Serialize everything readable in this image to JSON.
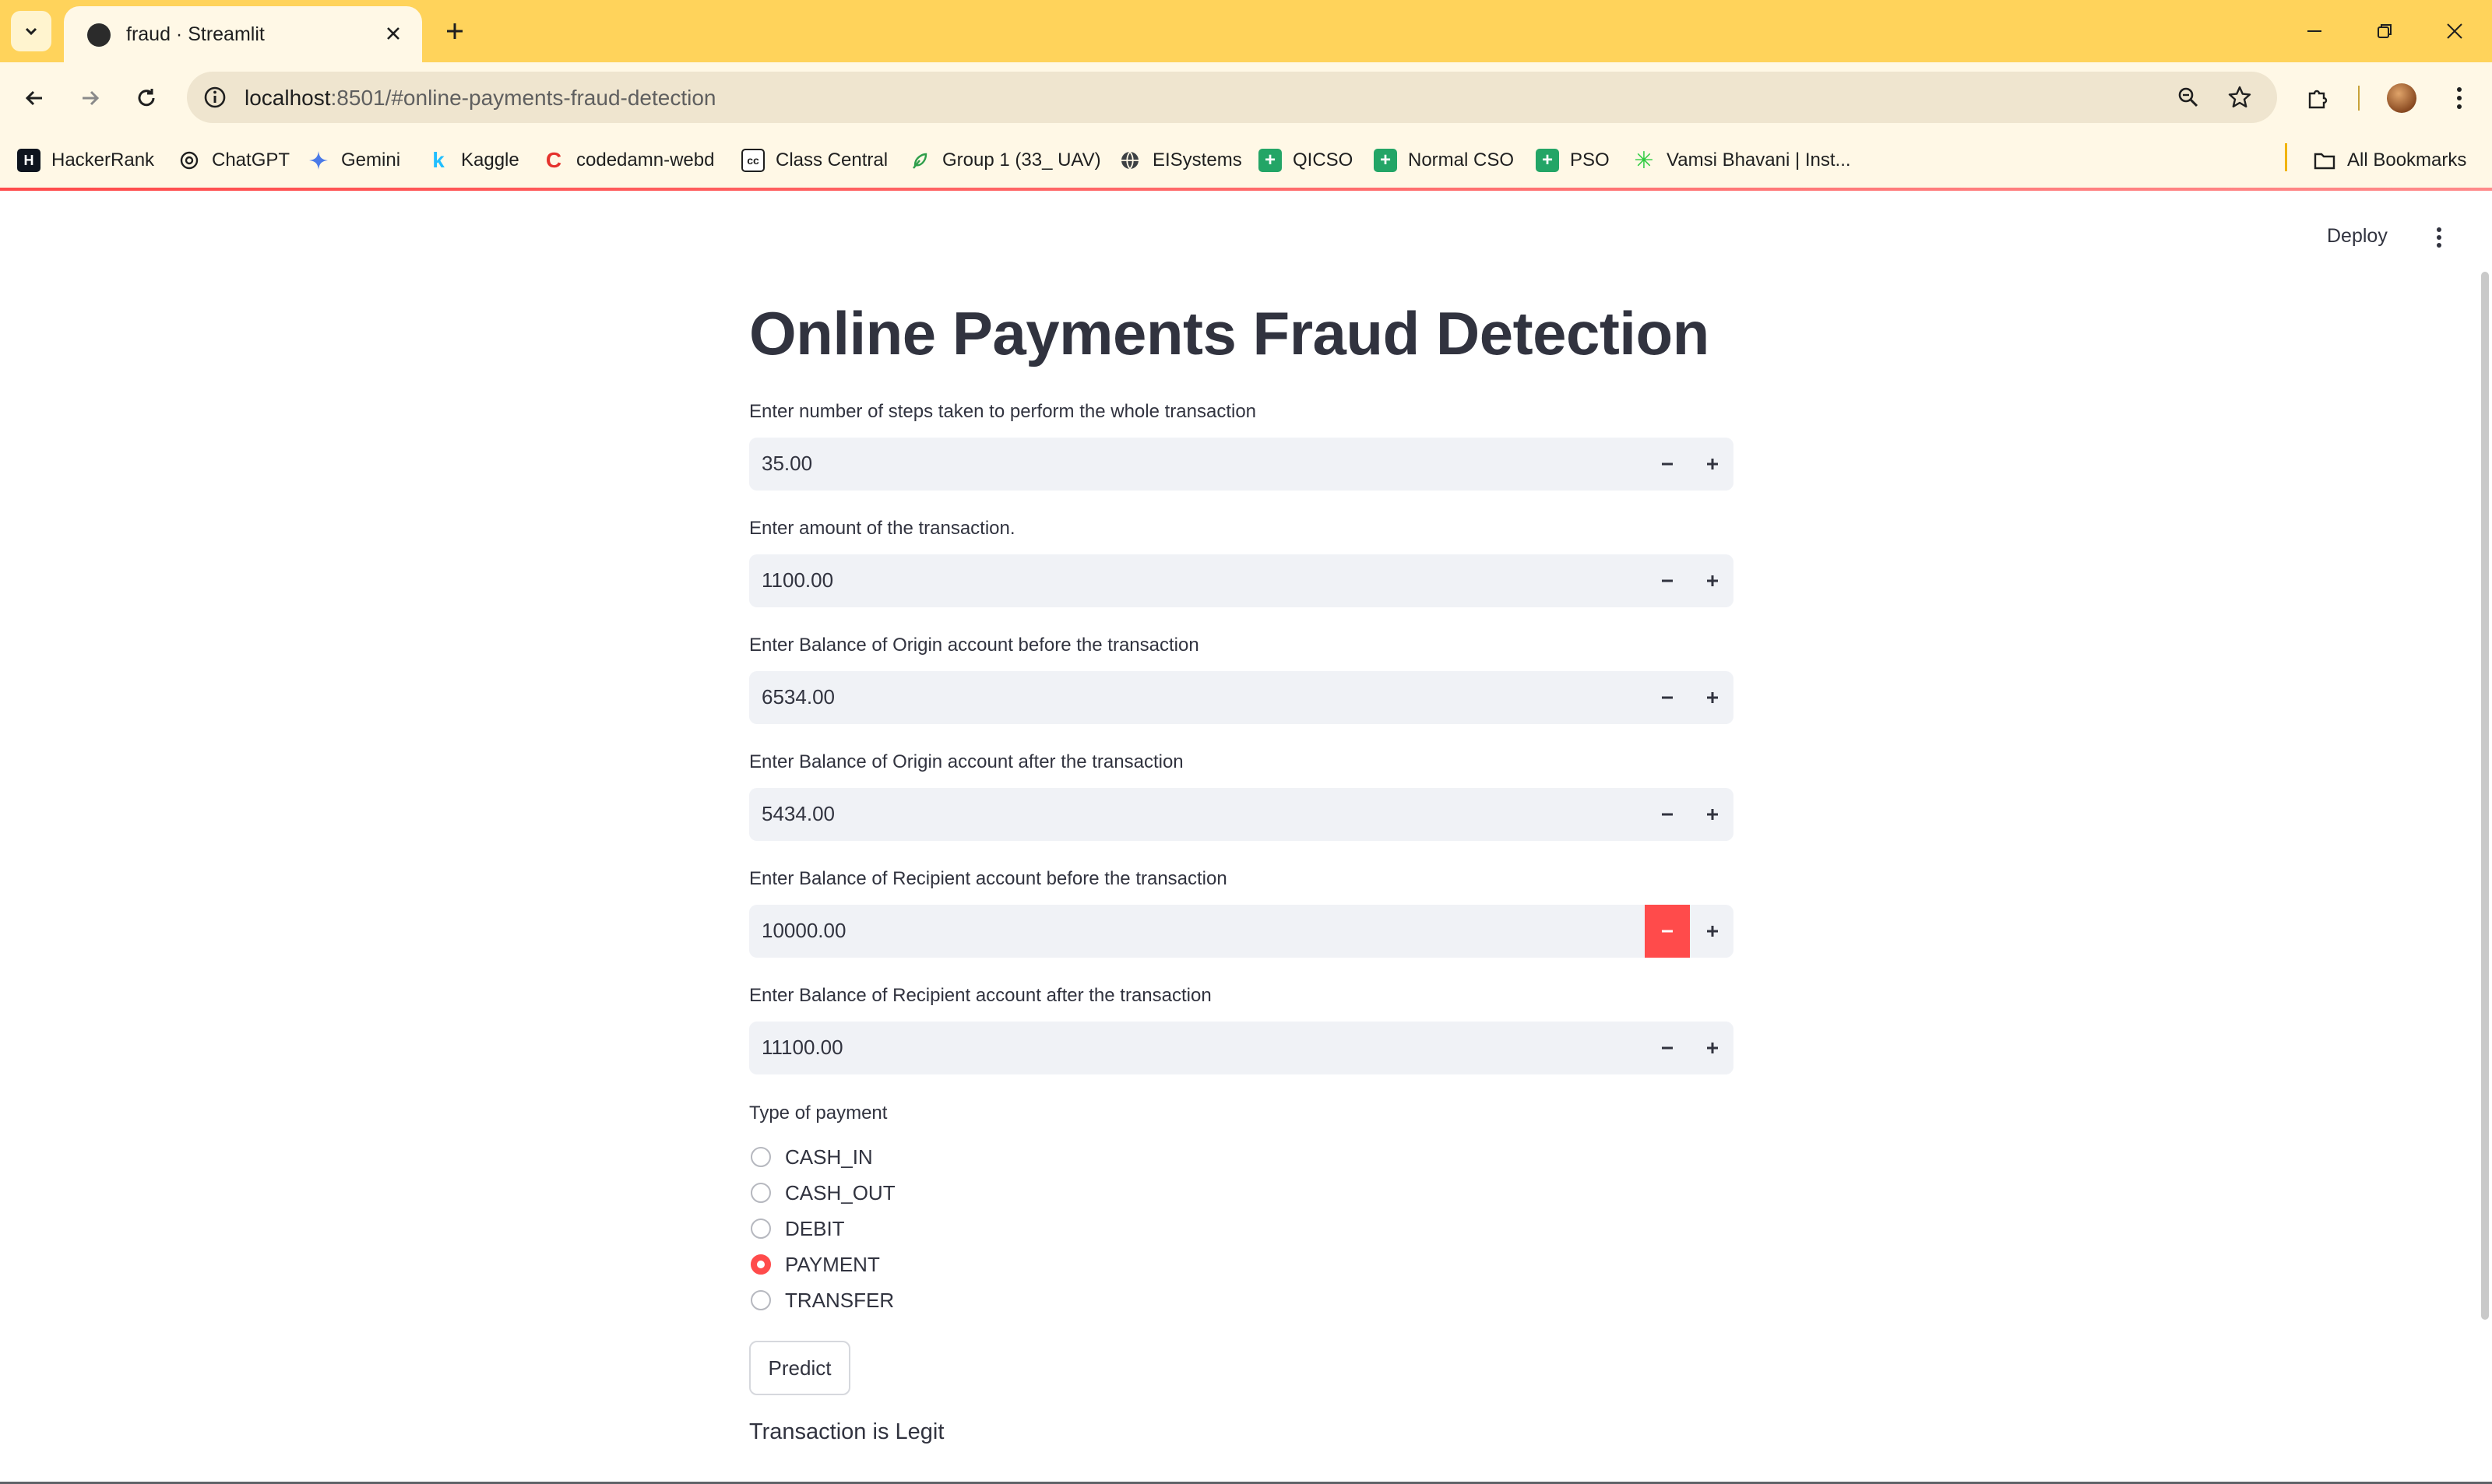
{
  "browser": {
    "tab_title": "fraud · Streamlit",
    "url_host": "localhost",
    "url_rest": ":8501/#online-payments-fraud-detection",
    "accent": "#ffd35b",
    "bookmarks": [
      {
        "label": "HackerRank",
        "icon": "hackerrank-icon"
      },
      {
        "label": "ChatGPT",
        "icon": "chatgpt-icon"
      },
      {
        "label": "Gemini",
        "icon": "gemini-icon"
      },
      {
        "label": "Kaggle",
        "icon": "kaggle-icon"
      },
      {
        "label": "codedamn-webd",
        "icon": "codedamn-icon"
      },
      {
        "label": "Class Central",
        "icon": "classcentral-icon"
      },
      {
        "label": "Group 1 (33_ UAV)",
        "icon": "group-icon"
      },
      {
        "label": "EISystems",
        "icon": "globe-icon"
      },
      {
        "label": "QICSO",
        "icon": "sheets-icon"
      },
      {
        "label": "Normal CSO",
        "icon": "sheets-icon"
      },
      {
        "label": "PSO",
        "icon": "sheets-icon"
      },
      {
        "label": "Vamsi Bhavani | Inst...",
        "icon": "sparkle-icon"
      }
    ],
    "all_bookmarks": "All Bookmarks"
  },
  "app": {
    "deploy_label": "Deploy",
    "title": "Online Payments Fraud Detection",
    "accent": "#ff4b4b",
    "fields": [
      {
        "label": "Enter number of steps taken to perform the whole transaction",
        "value": "35.00"
      },
      {
        "label": "Enter amount of the transaction.",
        "value": "1100.00"
      },
      {
        "label": "Enter Balance of Origin account before the transaction",
        "value": "6534.00"
      },
      {
        "label": "Enter Balance of Origin account after the transaction",
        "value": "5434.00"
      },
      {
        "label": "Enter Balance of Recipient account before the transaction",
        "value": "10000.00"
      },
      {
        "label": "Enter Balance of Recipient account after the transaction",
        "value": "11100.00"
      }
    ],
    "payment_type": {
      "label": "Type of payment",
      "options": [
        "CASH_IN",
        "CASH_OUT",
        "DEBIT",
        "PAYMENT",
        "TRANSFER"
      ],
      "selected": "PAYMENT"
    },
    "predict_label": "Predict",
    "result": "Transaction is Legit"
  }
}
